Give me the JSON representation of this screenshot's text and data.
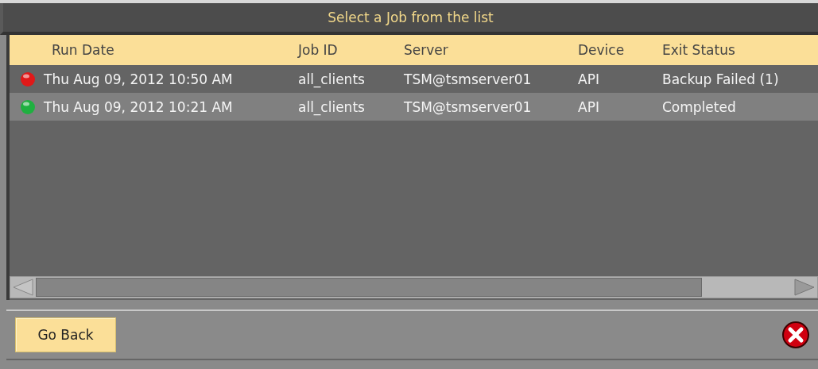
{
  "window": {
    "title": "Select a Job from the list"
  },
  "table": {
    "columns": [
      "Run Date",
      "Job ID",
      "Server",
      "Device",
      "Exit Status"
    ],
    "rows": [
      {
        "color": "#e01818",
        "cells": [
          "Thu Aug 09, 2012 10:50 AM",
          "all_clients",
          "TSM@tsmserver01",
          "API",
          "Backup Failed (1)"
        ]
      },
      {
        "color": "#1fb040",
        "cells": [
          "Thu Aug 09, 2012 10:21 AM",
          "all_clients",
          "TSM@tsmserver01",
          "API",
          "Completed"
        ]
      }
    ]
  },
  "buttons": [
    "Go Back"
  ]
}
